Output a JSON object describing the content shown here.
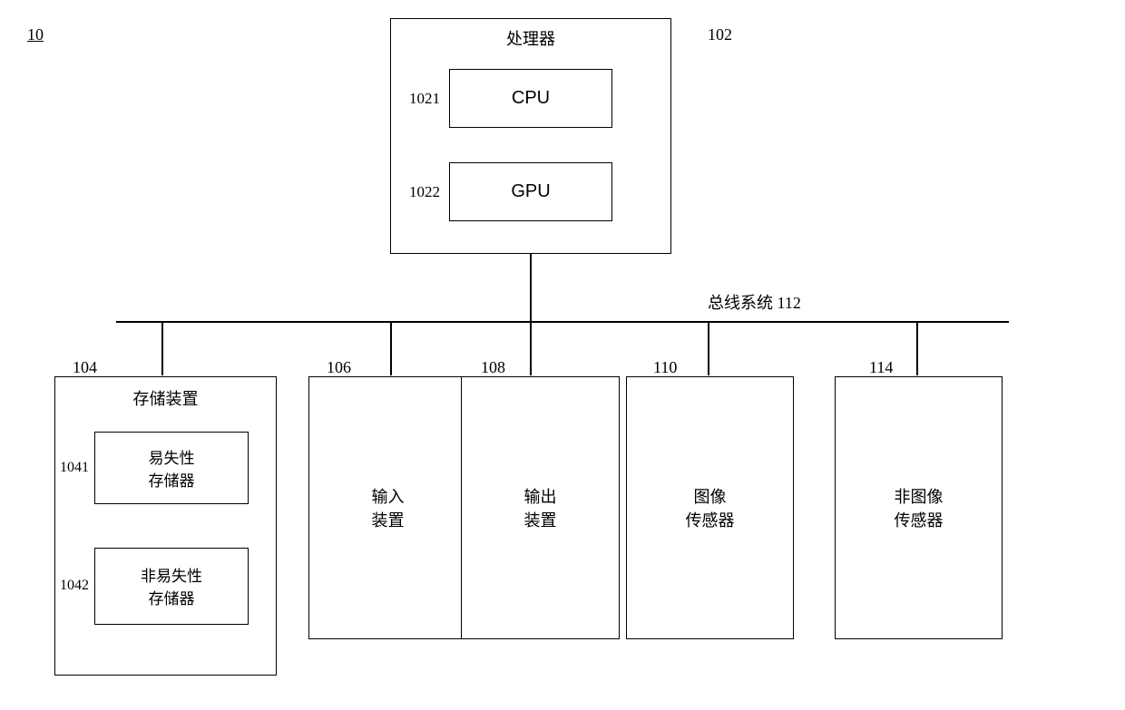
{
  "diagram": {
    "system_ref": "10",
    "processor": {
      "label": "处理器",
      "ref": "102",
      "cpu_ref": "1021",
      "cpu_label": "CPU",
      "gpu_ref": "1022",
      "gpu_label": "GPU"
    },
    "bus_label": "总线系统",
    "bus_ref": "112",
    "storage": {
      "ref": "104",
      "label": "存储装置",
      "volatile_ref": "1041",
      "volatile_label_1": "易失性",
      "volatile_label_2": "存储器",
      "nonvolatile_ref": "1042",
      "nonvolatile_label_1": "非易失性",
      "nonvolatile_label_2": "存储器"
    },
    "input": {
      "ref": "106",
      "label_1": "输入",
      "label_2": "装置"
    },
    "output": {
      "ref": "108",
      "label_1": "输出",
      "label_2": "装置"
    },
    "image_sensor": {
      "ref": "110",
      "label_1": "图像",
      "label_2": "传感器"
    },
    "non_image_sensor": {
      "ref": "114",
      "label_1": "非图像",
      "label_2": "传感器"
    }
  }
}
